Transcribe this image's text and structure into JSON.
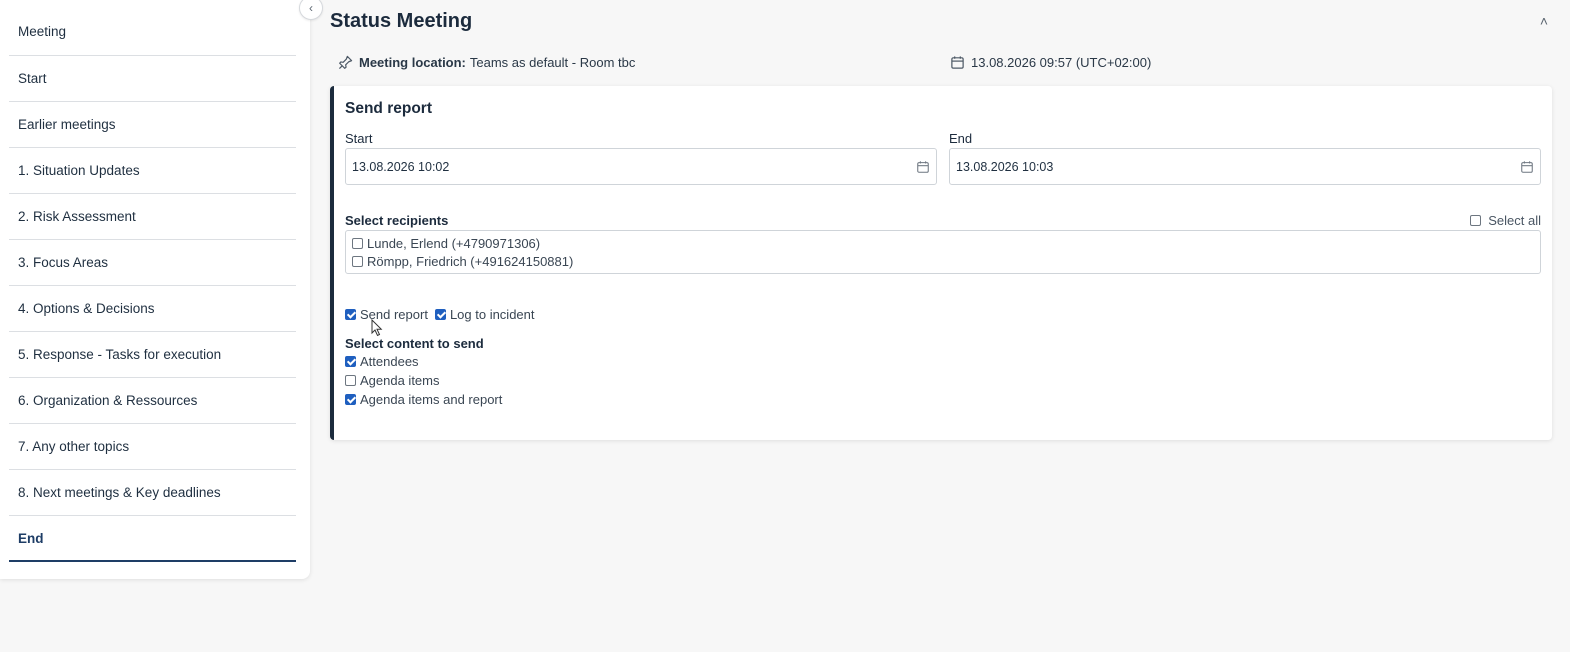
{
  "sidebar": {
    "items": [
      {
        "label": "Meeting"
      },
      {
        "label": "Start"
      },
      {
        "label": "Earlier meetings"
      },
      {
        "label": "1. Situation Updates"
      },
      {
        "label": "2. Risk Assessment"
      },
      {
        "label": "3. Focus Areas"
      },
      {
        "label": "4. Options & Decisions"
      },
      {
        "label": "5. Response - Tasks for execution"
      },
      {
        "label": "6. Organization & Ressources"
      },
      {
        "label": "7. Any other topics"
      },
      {
        "label": "8. Next meetings & Key deadlines"
      },
      {
        "label": "End"
      }
    ],
    "active_index": 11,
    "collapse_glyph": "‹"
  },
  "header": {
    "title": "Status Meeting",
    "collapse_glyph": "˄"
  },
  "meta": {
    "location_label": "Meeting location:",
    "location_value": "Teams as default - Room tbc",
    "datetime": "13.08.2026 09:57 (UTC+02:00)"
  },
  "report": {
    "title": "Send report",
    "start_label": "Start",
    "start_value": "13.08.2026 10:02",
    "end_label": "End",
    "end_value": "13.08.2026 10:03",
    "recipients_label": "Select recipients",
    "select_all_label": "Select all",
    "select_all_checked": false,
    "recipients": [
      {
        "label": "Lunde, Erlend (+4790971306)",
        "checked": false
      },
      {
        "label": "Römpp, Friedrich (+491624150881)",
        "checked": false
      }
    ],
    "options": [
      {
        "label": "Send report",
        "checked": true
      },
      {
        "label": "Log to incident",
        "checked": true
      }
    ],
    "content_label": "Select content to send",
    "content_items": [
      {
        "label": "Attendees",
        "checked": true
      },
      {
        "label": "Agenda items",
        "checked": false
      },
      {
        "label": "Agenda items and report",
        "checked": true
      }
    ]
  },
  "icons": {
    "location": "pin-icon",
    "calendar": "calendar-icon"
  },
  "colors": {
    "accent": "#1e3d66",
    "checkbox": "#1f5fbf",
    "background": "#f7f7f7"
  }
}
